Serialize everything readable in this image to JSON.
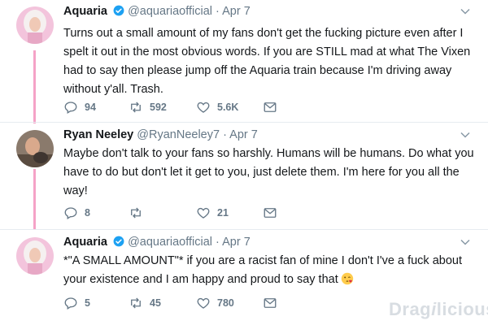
{
  "tweets": [
    {
      "name": "Aquaria",
      "handle": "@aquariaofficial",
      "dot": "·",
      "date": "Apr 7",
      "text": "Turns out a small amount of my fans don't get the fucking picture even after I spelt it out in the most obvious words. If you are STILL mad at what The Vixen had to say then please jump off the Aquaria train because I'm driving away without y'all. Trash.",
      "replies": "94",
      "retweets": "592",
      "likes": "5.6K"
    },
    {
      "name": "Ryan Neeley",
      "handle": "@RyanNeeley7",
      "dot": "·",
      "date": "Apr 7",
      "text": "Maybe don't talk to your fans so harshly. Humans will be humans. Do what you have to do but don't let it get to you, just delete them. I'm here for you all the way!",
      "replies": "8",
      "retweets": "",
      "likes": "21"
    },
    {
      "name": "Aquaria",
      "handle": "@aquariaofficial",
      "dot": "·",
      "date": "Apr 7",
      "text": "*\"A SMALL AMOUNT\"* if you are a racist fan of mine I don't I've a fuck about your existence and I am happy and proud to say that",
      "replies": "5",
      "retweets": "45",
      "likes": "780"
    }
  ],
  "watermark": {
    "part1": "Drag",
    "part2": "licious",
    "dot": "i"
  },
  "colors": {
    "verified": "#1da1f2",
    "thread": "#f5a3c7",
    "icon": "#657786",
    "text": "#14171a"
  }
}
